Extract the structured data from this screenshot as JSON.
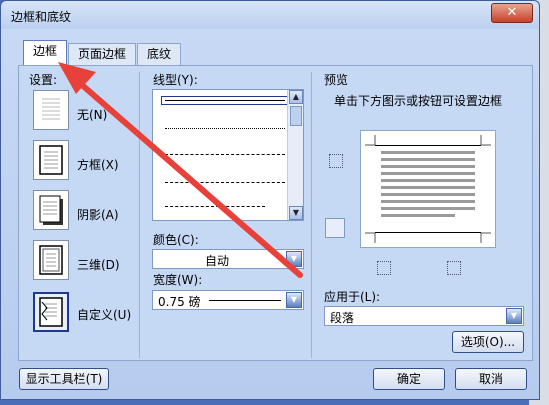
{
  "window": {
    "title": "边框和底纹",
    "close_label": "✕"
  },
  "tabs": [
    {
      "label": "边框",
      "active": true
    },
    {
      "label": "页面边框",
      "active": false
    },
    {
      "label": "底纹",
      "active": false
    }
  ],
  "settings": {
    "heading": "设置:",
    "items": [
      {
        "label": "无(N)"
      },
      {
        "label": "方框(X)"
      },
      {
        "label": "阴影(A)"
      },
      {
        "label": "三维(D)"
      },
      {
        "label": "自定义(U)"
      }
    ]
  },
  "line_style": {
    "heading": "线型(Y):"
  },
  "color": {
    "heading": "颜色(C):",
    "value": "自动"
  },
  "width": {
    "heading": "宽度(W):",
    "value": "0.75 磅"
  },
  "preview": {
    "heading": "预览",
    "hint": "单击下方图示或按钮可设置边框"
  },
  "apply_to": {
    "heading": "应用于(L):",
    "value": "段落"
  },
  "buttons": {
    "options": "选项(O)...",
    "show_toolbar": "显示工具栏(T)",
    "ok": "确定",
    "cancel": "取消"
  },
  "colors": {
    "annotation_arrow": "#e8413a",
    "accent": "#3d5c9a"
  }
}
